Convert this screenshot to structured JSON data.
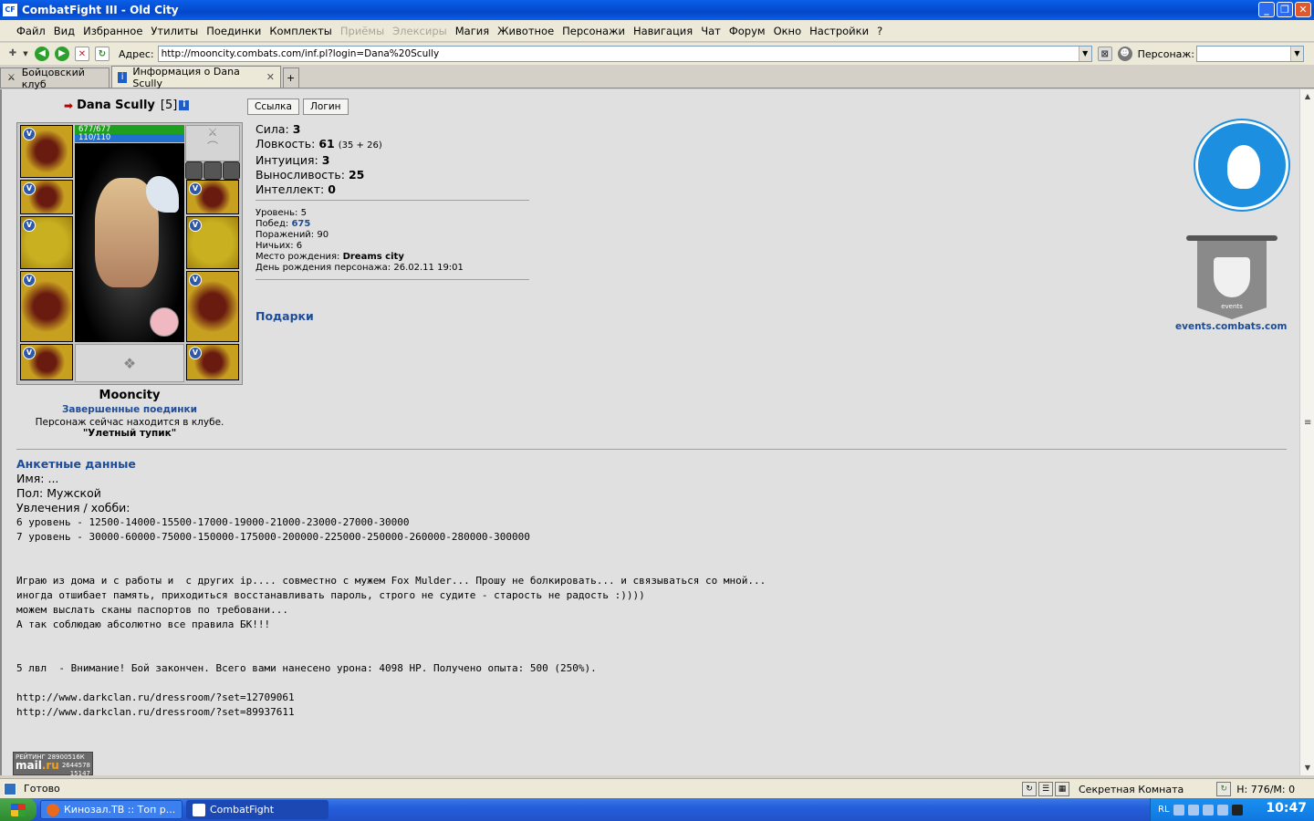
{
  "window": {
    "title": "CombatFight III - Old City",
    "app_icon": "CF"
  },
  "menu": {
    "items": [
      {
        "label": "Файл",
        "enabled": true
      },
      {
        "label": "Вид",
        "enabled": true
      },
      {
        "label": "Избранное",
        "enabled": true
      },
      {
        "label": "Утилиты",
        "enabled": true
      },
      {
        "label": "Поединки",
        "enabled": true
      },
      {
        "label": "Комплекты",
        "enabled": true
      },
      {
        "label": "Приёмы",
        "enabled": false
      },
      {
        "label": "Элексиры",
        "enabled": false
      },
      {
        "label": "Магия",
        "enabled": true
      },
      {
        "label": "Животное",
        "enabled": true
      },
      {
        "label": "Персонажи",
        "enabled": true
      },
      {
        "label": "Навигация",
        "enabled": true
      },
      {
        "label": "Чат",
        "enabled": true
      },
      {
        "label": "Форум",
        "enabled": true
      },
      {
        "label": "Окно",
        "enabled": true
      },
      {
        "label": "Настройки",
        "enabled": true
      },
      {
        "label": "?",
        "enabled": true
      }
    ]
  },
  "address": {
    "label": "Адрес:",
    "url": "http://mooncity.combats.com/inf.pl?login=Dana%20Scully",
    "character_label": "Персонаж:",
    "character_value": ""
  },
  "tabs": [
    {
      "label": "Бойцовский клуб",
      "active": false
    },
    {
      "label": "Информация о Dana Scully",
      "active": true
    }
  ],
  "character": {
    "name": "Dana Scully",
    "level_text": "[5]",
    "hp": "677/677",
    "mana": "110/110",
    "city": "Mooncity",
    "battles_link": "Завершенные поединки",
    "location_text": "Персонаж сейчас находится в клубе.",
    "room": "\"Улетный тупик\""
  },
  "buttons": {
    "link": "Ссылка",
    "login": "Логин"
  },
  "stats": [
    {
      "label": "Сила:",
      "value": "3",
      "extra": ""
    },
    {
      "label": "Ловкость:",
      "value": "61",
      "extra": "(35 + 26)"
    },
    {
      "label": "Интуиция:",
      "value": "3",
      "extra": ""
    },
    {
      "label": "Выносливость:",
      "value": "25",
      "extra": ""
    },
    {
      "label": "Интеллект:",
      "value": "0",
      "extra": ""
    }
  ],
  "info": {
    "level": {
      "label": "Уровень:",
      "value": "5"
    },
    "wins": {
      "label": "Побед:",
      "value": "675"
    },
    "losses": {
      "label": "Поражений:",
      "value": "90"
    },
    "draws": {
      "label": "Ничьих:",
      "value": "6"
    },
    "birthplace": {
      "label": "Место рождения:",
      "value": "Dreams city"
    },
    "birthday": {
      "label": "День рождения персонажа:",
      "value": "26.02.11 19:01"
    }
  },
  "gifts": "Подарки",
  "events_link": "events.combats.com",
  "events_banner_text": "events",
  "profile": {
    "title": "Анкетные данные",
    "name": "Имя: ...",
    "gender": "Пол: Мужской",
    "hobbies": "Увлечения / хобби:",
    "lines": [
      "6 уровень - 12500-14000-15500-17000-19000-21000-23000-27000-30000",
      "7 уровень - 30000-60000-75000-150000-175000-200000-225000-250000-260000-280000-300000",
      "Играю из дома и с работы и  с других ip.... совместно с мужем Fox Mulder... Прошу не болкировать... и связываться со мной...",
      "иногда отшибает память, приходиться восстанавливать пароль, строго не судите - старость не радость :))))",
      "можем выслать сканы паспортов по требовани...",
      "А так соблюдаю абсолютно все правила БК!!!",
      "5 лвл  - Внимание! Бой закончен. Всего вами нанесено урона: 4098 HP. Получено опыта: 500 (250%).",
      "http://www.darkclan.ru/dressroom/?set=12709061",
      "http://www.darkclan.ru/dressroom/?set=89937611"
    ]
  },
  "rating": {
    "top": "РЕЙТИНГ 28900516К",
    "n1": "2644578",
    "n2": "15147",
    "logo_a": "mail",
    "logo_b": ".ru"
  },
  "status": {
    "ready": "Готово",
    "room": "Секретная Комната",
    "hm": "H: 776/M: 0"
  },
  "taskbar": {
    "tasks": [
      {
        "label": "Кинозал.ТВ :: Топ р...",
        "active": false
      },
      {
        "label": "CombatFight",
        "active": true
      }
    ],
    "lang": "RL",
    "clock": "10:47"
  }
}
